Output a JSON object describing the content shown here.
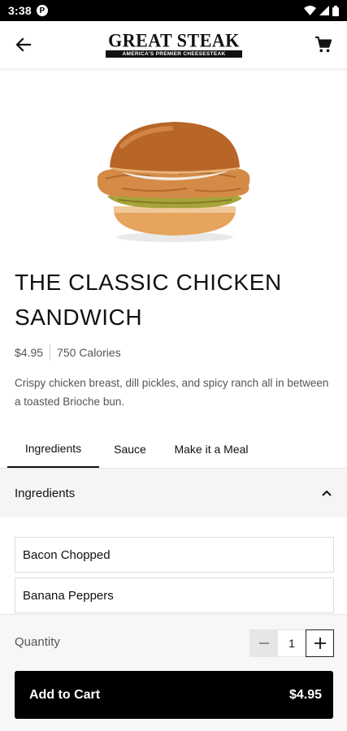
{
  "status_bar": {
    "time": "3:38",
    "app_icon_letter": "P"
  },
  "header": {
    "back_icon": "arrow-left-icon",
    "logo_text": "GREAT STEAK",
    "logo_tagline": "AMERICA'S PREMIER CHEESESTEAK",
    "cart_icon": "cart-icon"
  },
  "product": {
    "title": "THE CLASSIC CHICKEN SANDWICH",
    "price": "$4.95",
    "calories": "750 Calories",
    "description": "Crispy chicken breast, dill pickles, and spicy ranch all in between a toasted Brioche bun."
  },
  "tabs": [
    {
      "label": "Ingredients",
      "active": true
    },
    {
      "label": "Sauce",
      "active": false
    },
    {
      "label": "Make it a Meal",
      "active": false
    }
  ],
  "ingredients_section": {
    "title": "Ingredients",
    "expanded": true,
    "items": [
      "Bacon Chopped",
      "Banana Peppers"
    ]
  },
  "order": {
    "quantity_label": "Quantity",
    "quantity": "1",
    "add_to_cart_label": "Add to Cart",
    "total_price": "$4.95"
  },
  "colors": {
    "primary": "#000000",
    "panel_background": "#f5f5f5",
    "text_secondary": "#555555"
  }
}
